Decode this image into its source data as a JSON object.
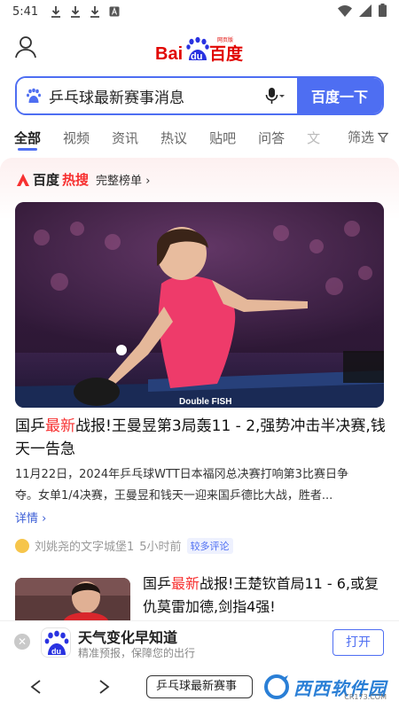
{
  "status_bar": {
    "time": "5:41"
  },
  "header": {
    "logo_text_bai": "Bai",
    "logo_text_du": "du",
    "logo_text_cn": "百度",
    "logo_small": "网页版"
  },
  "search": {
    "query": "乒乓球最新赛事消息",
    "button_label": "百度一下"
  },
  "tabs": [
    {
      "label": "全部",
      "active": true
    },
    {
      "label": "视频"
    },
    {
      "label": "资讯"
    },
    {
      "label": "热议"
    },
    {
      "label": "贴吧"
    },
    {
      "label": "问答"
    },
    {
      "label": "文"
    }
  ],
  "filter_label": "筛选",
  "hot": {
    "brand_a": "百度",
    "brand_b": "热搜",
    "link": "完整榜单"
  },
  "feature": {
    "title_pre": "国乒",
    "title_hl": "最新",
    "title_post": "战报!王曼昱第3局轰11 - 2,强势冲击半决赛,钱天一告急",
    "desc": "11月22日，2024年乒乓球WTT日本福冈总决赛打响第3比赛日争夺。女单1/4决赛，王曼昱和钱天一迎来国乒德比大战，胜者...",
    "detail_link": "详情",
    "source": "刘姚尧的文字城堡1",
    "time": "5小时前",
    "badge": "较多评论",
    "img_caption": "Double FISH"
  },
  "second": {
    "title_pre": "国乒",
    "title_hl": "最新",
    "title_post": "战报!王楚钦首局11 - 6,或复仇莫雷加德,剑指4强!"
  },
  "app_banner": {
    "title": "天气变化早知道",
    "subtitle": "精准预报，保障您的出行",
    "open_label": "打开",
    "icon_text": "du"
  },
  "bottom_nav": {
    "query": "乒乓球最新赛事"
  },
  "watermark": {
    "text": "西西软件园",
    "sub": "CR173.COM"
  },
  "colors": {
    "accent": "#4e6ef2",
    "hot_red": "#f73131"
  }
}
